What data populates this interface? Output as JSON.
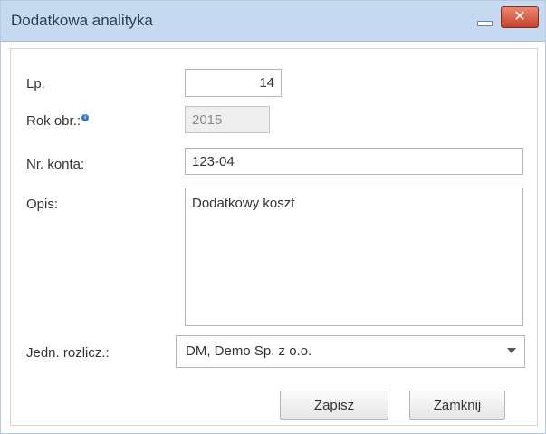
{
  "window": {
    "title": "Dodatkowa analityka",
    "minimize_icon": "minimize-icon",
    "close_icon": "close-icon",
    "close_glyph": "✕"
  },
  "form": {
    "lp": {
      "label": "Lp.",
      "value": "14"
    },
    "rok": {
      "label": "Rok obr.:",
      "value": "2015",
      "info_icon": "info-icon"
    },
    "konto": {
      "label": "Nr. konta:",
      "value": "123-04"
    },
    "opis": {
      "label": "Opis:",
      "value": "Dodatkowy koszt"
    },
    "jedn": {
      "label": "Jedn. rozlicz.:",
      "value": "DM, Demo Sp. z o.o.",
      "arrow_icon": "dropdown-arrow-icon"
    }
  },
  "buttons": {
    "save": "Zapisz",
    "close": "Zamknij"
  },
  "colors": {
    "titlebar": "#c5d9f1",
    "close_button": "#c8412a",
    "info_dot": "#3d74c6"
  }
}
